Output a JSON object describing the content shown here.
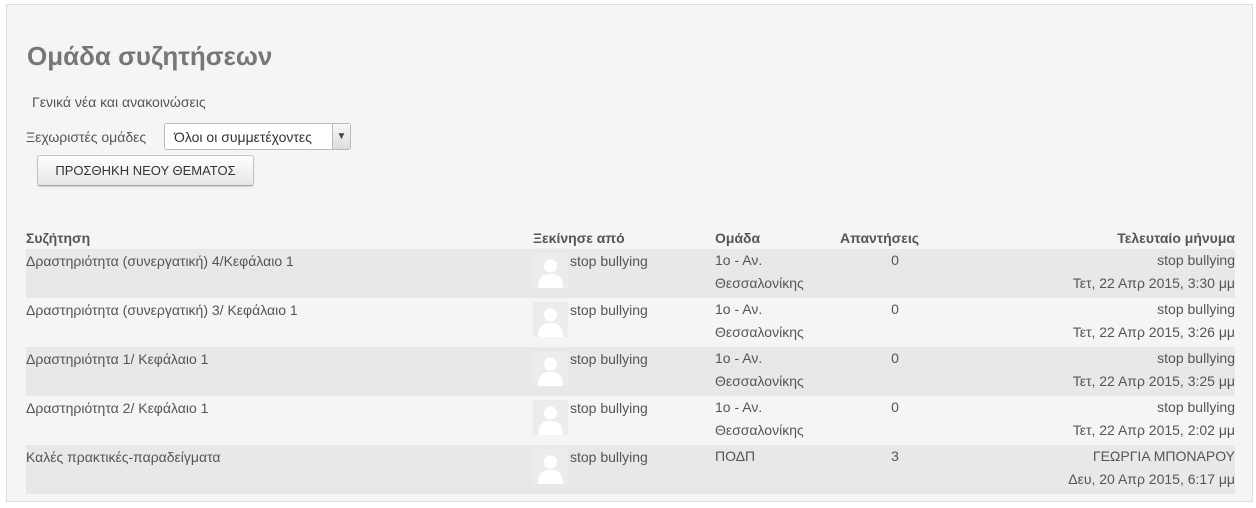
{
  "page": {
    "title": "Ομάδα συζητήσεων",
    "intro": "Γενικά νέα και ανακοινώσεις"
  },
  "groups": {
    "label": "Ξεχωριστές ομάδες",
    "selected": "Όλοι οι συμμετέχοντες"
  },
  "add_button": "ΠΡΟΣΘΗΚΗ ΝΕΟΥ ΘΕΜΑΤΟΣ",
  "table": {
    "headers": {
      "topic": "Συζήτηση",
      "started_by": "Ξεκίνησε από",
      "group": "Ομάδα",
      "replies": "Απαντήσεις",
      "last_post": "Τελευταίο μήνυμα"
    },
    "rows": [
      {
        "topic": "Δραστηριότητα (συνεργατική) 4/Κεφάλαιο 1",
        "started_by": "stop bullying",
        "group_line1": "1ο - Αν.",
        "group_line2": "Θεσσαλονίκης",
        "replies": "0",
        "last_user": "stop bullying",
        "last_date": "Τετ, 22 Απρ 2015, 3:30 μμ"
      },
      {
        "topic": "Δραστηριότητα (συνεργατική) 3/ Κεφάλαιο 1",
        "started_by": "stop bullying",
        "group_line1": "1ο - Αν.",
        "group_line2": "Θεσσαλονίκης",
        "replies": "0",
        "last_user": "stop bullying",
        "last_date": "Τετ, 22 Απρ 2015, 3:26 μμ"
      },
      {
        "topic": "Δραστηριότητα 1/ Κεφάλαιο 1",
        "started_by": "stop bullying",
        "group_line1": "1ο - Αν.",
        "group_line2": "Θεσσαλονίκης",
        "replies": "0",
        "last_user": "stop bullying",
        "last_date": "Τετ, 22 Απρ 2015, 3:25 μμ"
      },
      {
        "topic": "Δραστηριότητα 2/ Κεφάλαιο 1",
        "started_by": "stop bullying",
        "group_line1": "1ο - Αν.",
        "group_line2": "Θεσσαλονίκης",
        "replies": "0",
        "last_user": "stop bullying",
        "last_date": "Τετ, 22 Απρ 2015, 2:02 μμ"
      },
      {
        "topic": "Καλές πρακτικές-παραδείγματα",
        "started_by": "stop bullying",
        "group_line1": "ΠΟΔΠ",
        "group_line2": "",
        "replies": "3",
        "last_user": "ΓΕΩΡΓΙΑ ΜΠΟΝΑΡΟΥ",
        "last_date": "Δευ, 20 Απρ 2015, 6:17 μμ"
      }
    ]
  }
}
